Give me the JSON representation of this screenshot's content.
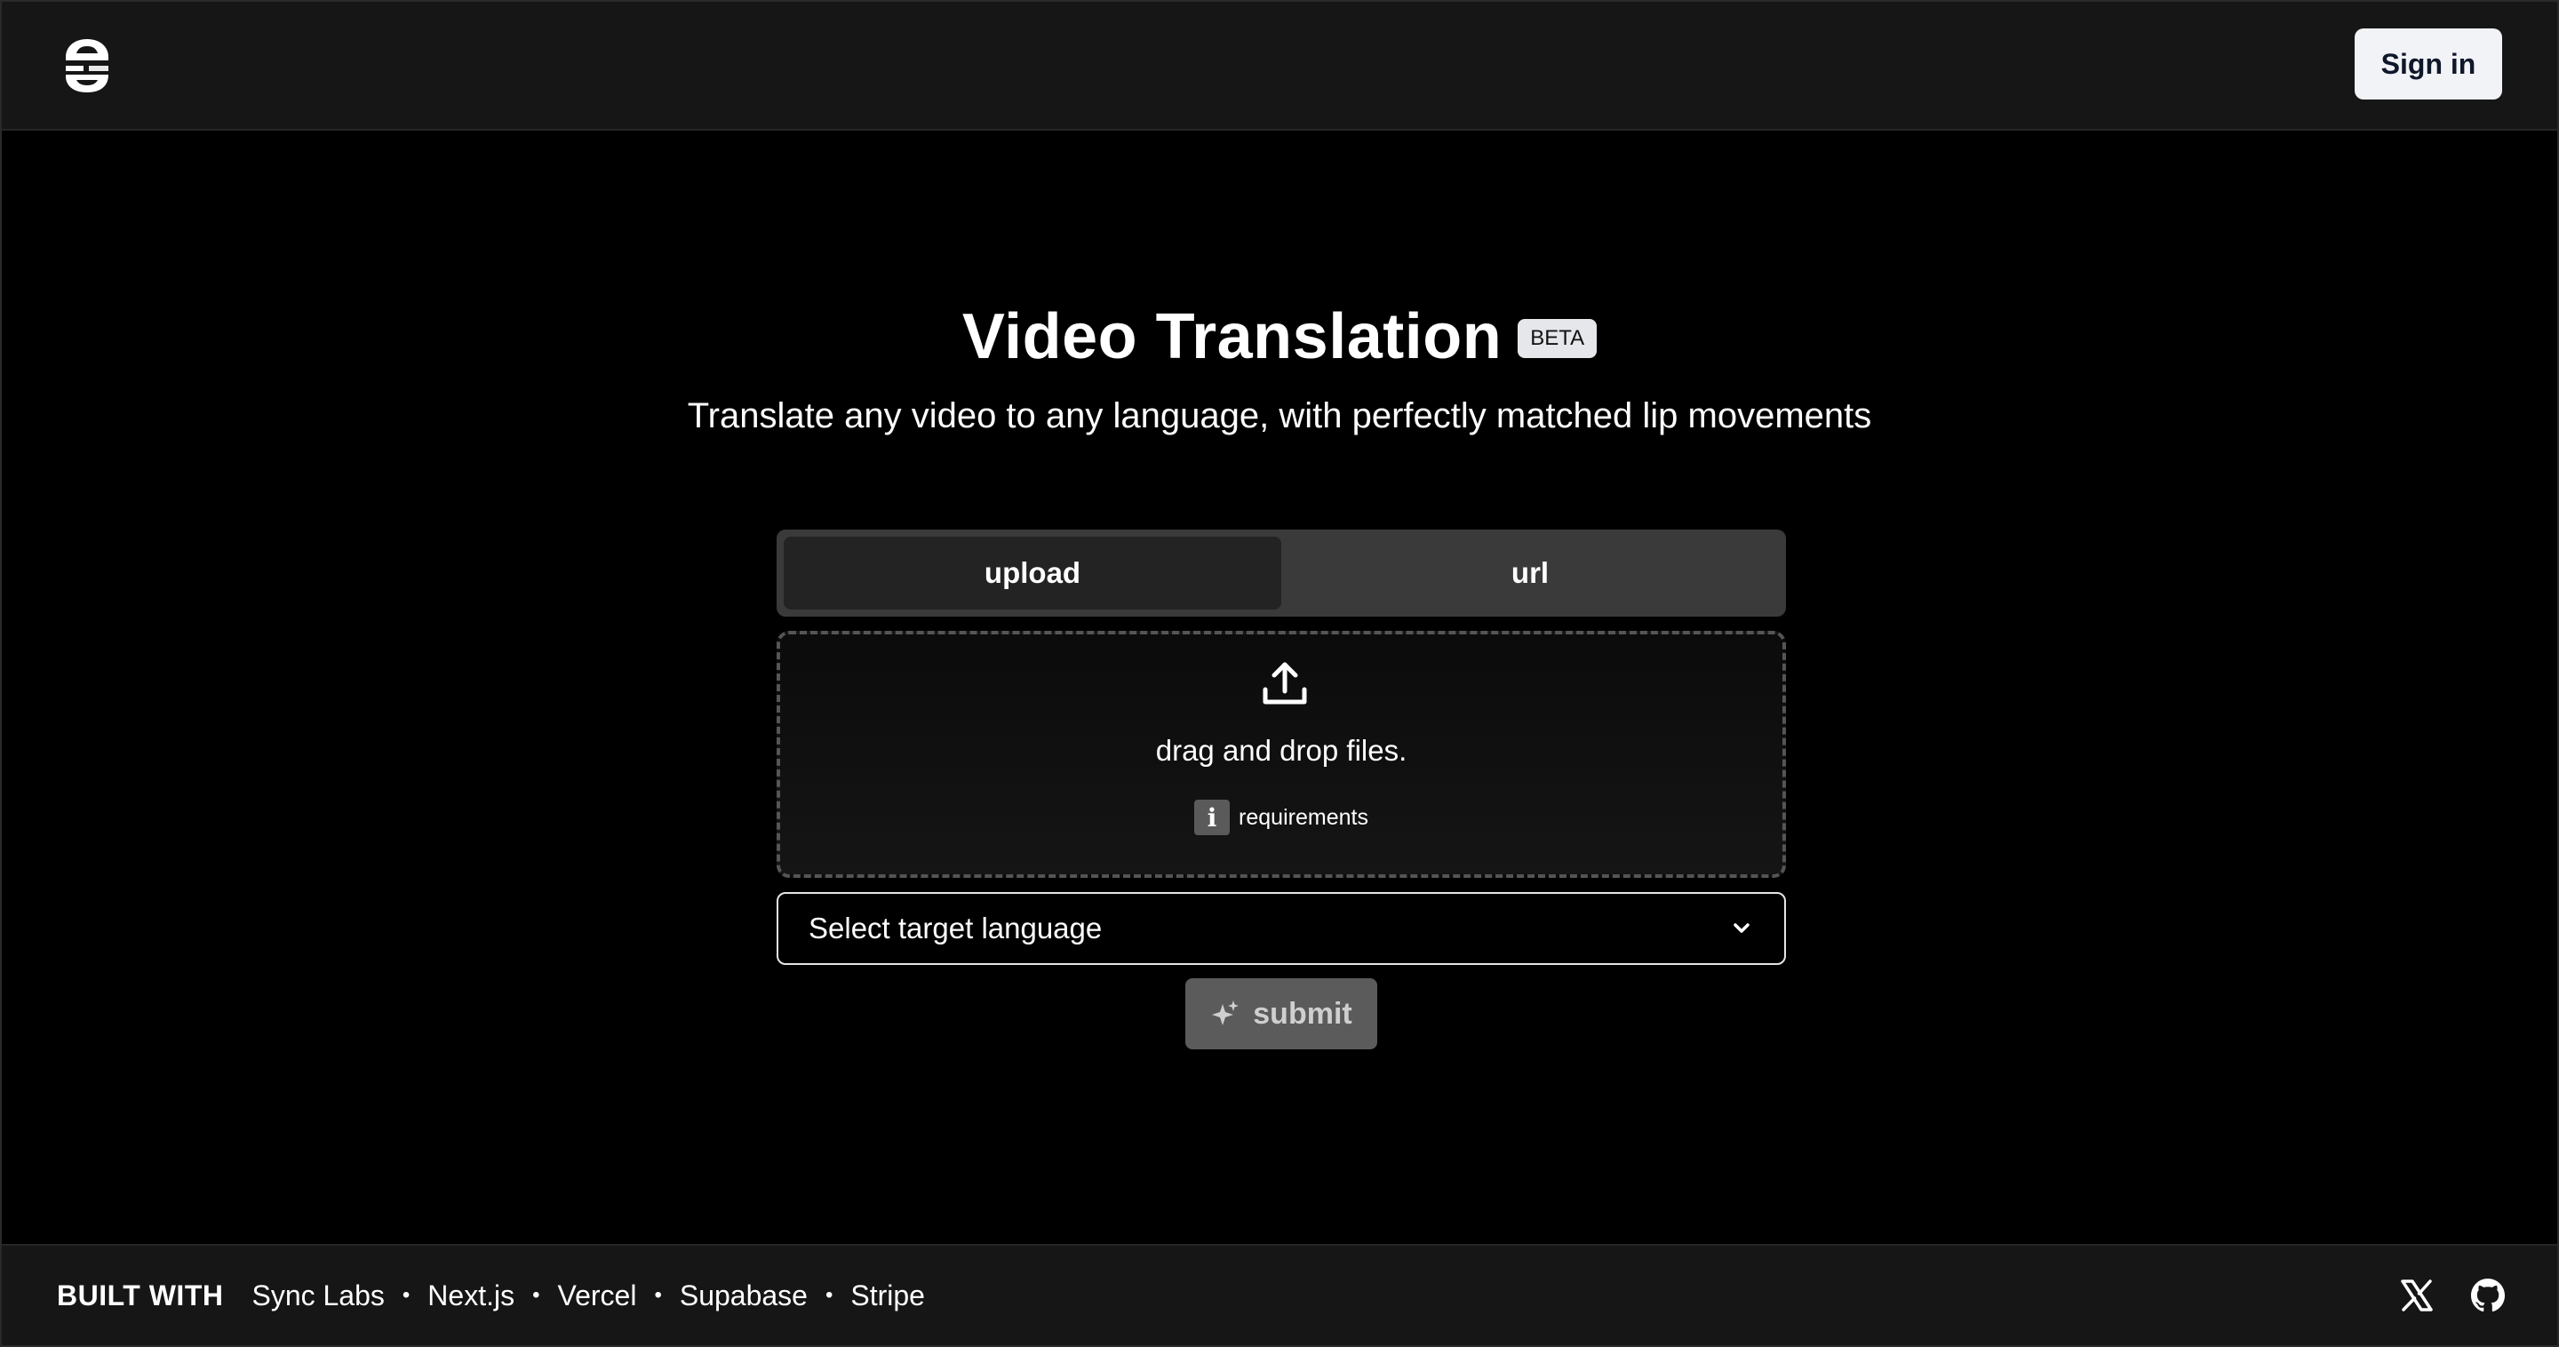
{
  "header": {
    "logo_icon": "sync-labs-logo-icon",
    "signin_label": "Sign in"
  },
  "hero": {
    "title": "Video Translation",
    "badge": "BETA",
    "subtitle": "Translate any video to any language, with perfectly matched lip movements"
  },
  "tabs": [
    {
      "label": "upload",
      "active": true
    },
    {
      "label": "url",
      "active": false
    }
  ],
  "dropzone": {
    "icon": "upload-icon",
    "text": "drag and drop files.",
    "info_icon": "info-icon",
    "info_glyph": "i",
    "requirements_label": "requirements"
  },
  "language_select": {
    "placeholder": "Select target language",
    "icon": "chevron-down-icon"
  },
  "submit": {
    "icon": "sparkles-icon",
    "label": "submit"
  },
  "footer": {
    "built_with_label": "BUILT WITH",
    "links": [
      "Sync Labs",
      "Next.js",
      "Vercel",
      "Supabase",
      "Stripe"
    ],
    "separator": "•",
    "social_icons": [
      "x-icon",
      "github-icon"
    ]
  },
  "colors": {
    "background": "#000000",
    "header_bg": "#161616",
    "signin_bg": "#f1f3f6",
    "tabs_bg": "#3a3a3a",
    "tab_active_bg": "#232323",
    "submit_bg": "#5b5b5b"
  }
}
